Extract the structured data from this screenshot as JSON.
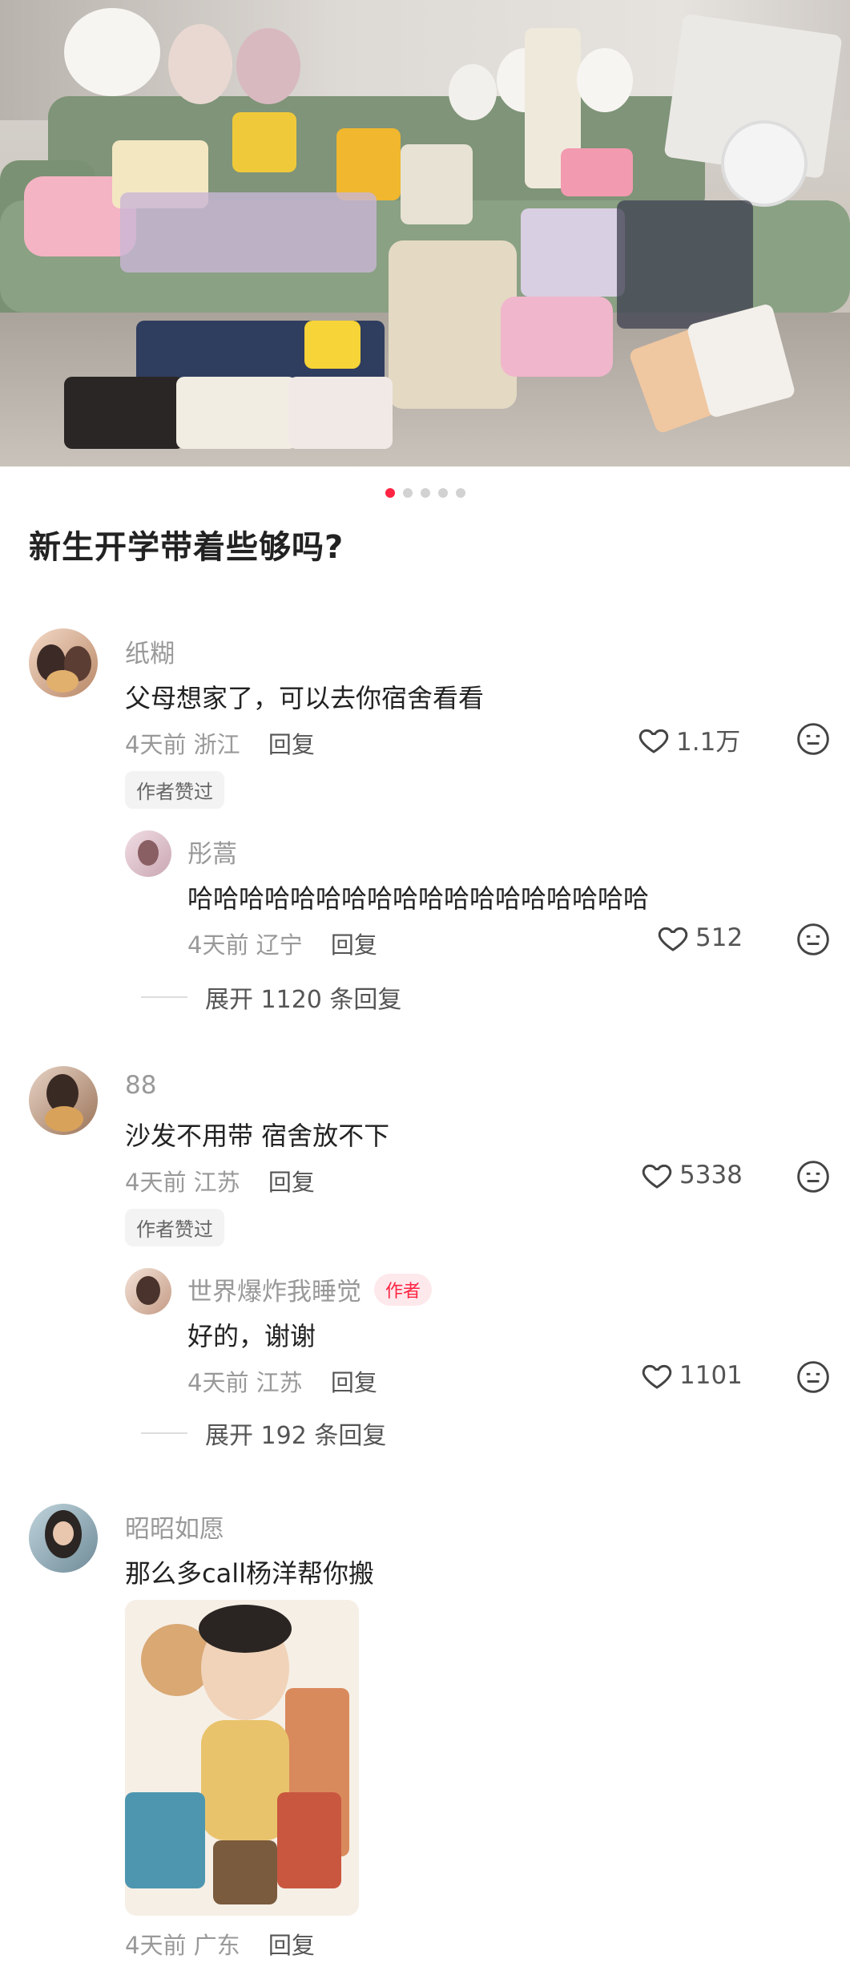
{
  "post": {
    "title": "新生开学带着些够吗?",
    "carousel": {
      "count": 5,
      "active_index": 0
    }
  },
  "colors": {
    "accent": "#ff2442",
    "muted": "#999999"
  },
  "comments": [
    {
      "username": "纸糊",
      "text": "父母想家了，可以去你宿舍看看",
      "time": "4天前",
      "location": "浙江",
      "reply_label": "回复",
      "likes": "1.1万",
      "badge": "作者赞过",
      "replies": [
        {
          "username": "彤蒿",
          "text": "哈哈哈哈哈哈哈哈哈哈哈哈哈哈哈哈哈哈",
          "time": "4天前",
          "location": "辽宁",
          "reply_label": "回复",
          "likes": "512"
        }
      ],
      "expand_label": "展开 1120 条回复"
    },
    {
      "username": "88",
      "text": "沙发不用带 宿舍放不下",
      "time": "4天前",
      "location": "江苏",
      "reply_label": "回复",
      "likes": "5338",
      "badge": "作者赞过",
      "replies": [
        {
          "username": "世界爆炸我睡觉",
          "author_badge": "作者",
          "text": "好的，谢谢",
          "time": "4天前",
          "location": "江苏",
          "reply_label": "回复",
          "likes": "1101"
        }
      ],
      "expand_label": "展开 192 条回复"
    },
    {
      "username": "昭昭如愿",
      "text": "那么多call杨洋帮你搬",
      "time": "4天前",
      "location": "广东",
      "reply_label": "回复"
    }
  ],
  "icons": {
    "like": "heart-outline-icon",
    "emoji": "neutral-face-icon"
  }
}
